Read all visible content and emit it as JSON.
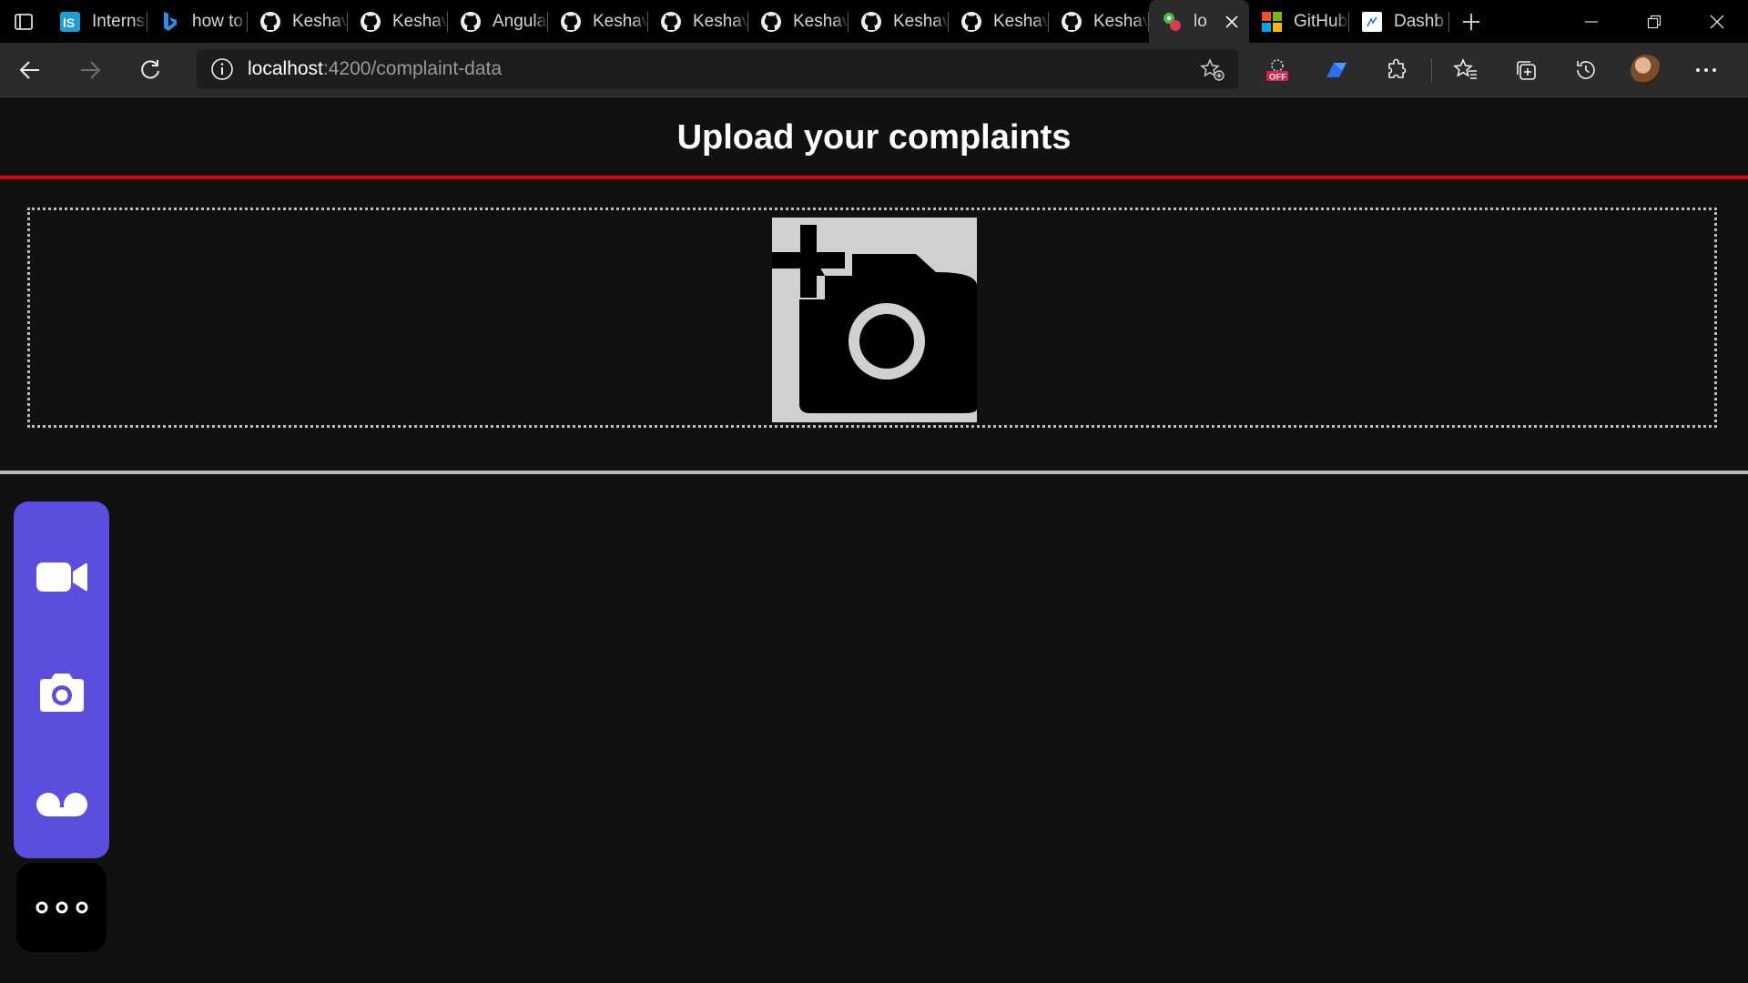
{
  "browser": {
    "tabs": [
      {
        "title": "Interns",
        "favicon": "internshala-icon"
      },
      {
        "title": "how to",
        "favicon": "bing-icon"
      },
      {
        "title": "Keshav",
        "favicon": "github-icon"
      },
      {
        "title": "Keshav",
        "favicon": "github-icon"
      },
      {
        "title": "Angula",
        "favicon": "github-icon"
      },
      {
        "title": "Keshav",
        "favicon": "github-icon"
      },
      {
        "title": "Keshav",
        "favicon": "github-icon"
      },
      {
        "title": "Keshav",
        "favicon": "github-icon"
      },
      {
        "title": "Keshav",
        "favicon": "github-icon"
      },
      {
        "title": "Keshav",
        "favicon": "github-icon"
      },
      {
        "title": "Keshav",
        "favicon": "github-icon"
      },
      {
        "title": "lo",
        "favicon": "app-icon",
        "active": true
      },
      {
        "title": "GitHub",
        "favicon": "microsoft-icon"
      },
      {
        "title": "Dashb",
        "favicon": "dashboard-icon"
      }
    ],
    "address": {
      "host": "localhost",
      "path": ":4200/complaint-data"
    },
    "extension_badge": "OFF",
    "accent_color": "#5b4dde"
  },
  "page": {
    "title": "Upload your complaints"
  }
}
